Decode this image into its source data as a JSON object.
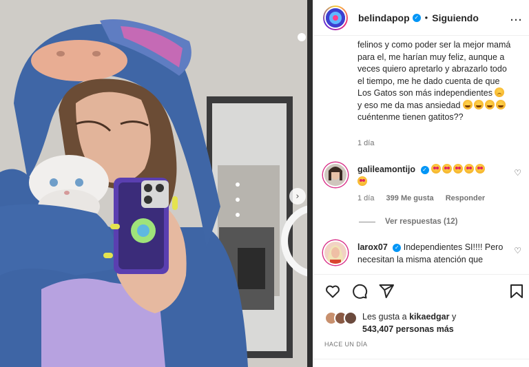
{
  "header": {
    "username": "belindapop",
    "separator": "•",
    "follow_status": "Siguiendo",
    "more_icon": "…"
  },
  "caption": {
    "text": "felinos y como poder ser la mejor mamá para el, me harían muy feliz, aunque a veces quiero apretarlo y abrazarlo todo el tiempo, me he dado cuenta de que Los Gatos son más independientes",
    "text_b": " y eso me da mas ansiedad",
    "text_c": " cuéntenme tienen gatitos??",
    "time": "1 día"
  },
  "comments": [
    {
      "username": "galileamontijo",
      "text": "",
      "time": "1 día",
      "likes": "399 Me gusta",
      "reply_label": "Responder",
      "see_replies": "Ver respuestas (12)"
    },
    {
      "username": "larox07",
      "text": "Independientes SI!!!! Pero necesitan la misma atención que"
    }
  ],
  "likes": {
    "prefix": "Les gusta a ",
    "user": "kikaedgar",
    "mid": " y",
    "count": "543,407 personas más"
  },
  "post_date": "HACE UN DÍA",
  "icons": {
    "next": "chevron-right-icon",
    "like": "heart-icon",
    "comment": "comment-icon",
    "share": "send-icon",
    "save": "bookmark-icon"
  },
  "colors": {
    "verified": "#0095f6",
    "muted": "#737373",
    "text": "#262626",
    "hoodie": "#3f66a6"
  }
}
